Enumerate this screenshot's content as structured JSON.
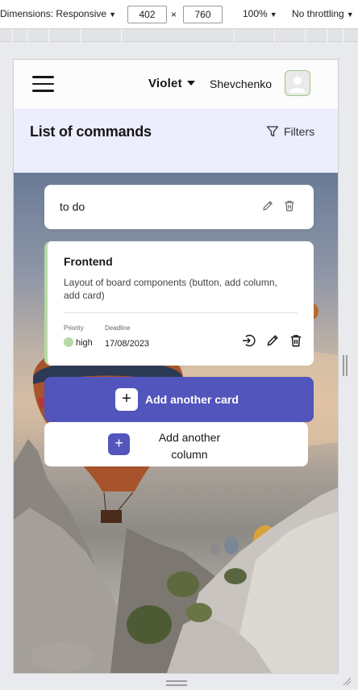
{
  "devtools": {
    "dimensions_label": "Dimensions: Responsive",
    "width_value": "402",
    "times": "×",
    "height_value": "760",
    "zoom": "100%",
    "throttling": "No throttling"
  },
  "header": {
    "board_name": "Violet",
    "user_name": "Shevchenko"
  },
  "subheader": {
    "title": "List of commands",
    "filters_label": "Filters"
  },
  "column": {
    "title": "to do"
  },
  "card": {
    "title": "Frontend",
    "description": "Layout of board components (button, add column, add card)",
    "priority_label": "Priority",
    "priority_value": "high",
    "priority_color": "#b7d9a6",
    "deadline_label": "Deadline",
    "deadline_value": "17/08/2023"
  },
  "add_card": {
    "plus": "+",
    "label": "Add another card"
  },
  "add_column": {
    "plus": "+",
    "label": "Add another column"
  },
  "colors": {
    "accent": "#5255bc",
    "subheader_bg": "#ecedfd",
    "avatar_border": "#9dc888"
  },
  "icons": {
    "menu": "hamburger-icon",
    "board_dropdown": "chevron-down-icon",
    "avatar": "user-avatar-icon",
    "filters": "filter-icon",
    "column_edit": "pencil-icon",
    "column_delete": "trash-icon",
    "card_move": "arrow-right-circle-icon",
    "card_edit": "pencil-icon",
    "card_delete": "trash-icon"
  }
}
